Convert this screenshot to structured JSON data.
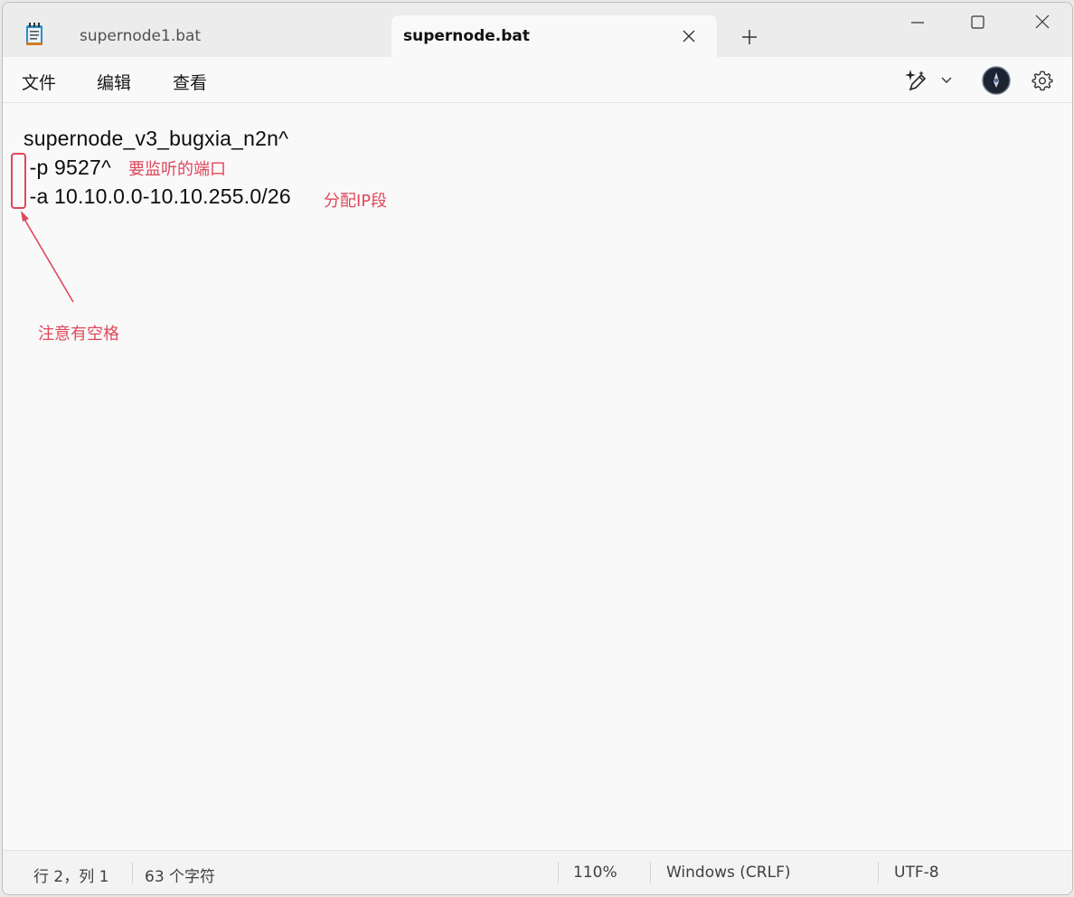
{
  "tabs": [
    {
      "label": "supernode1.bat",
      "active": false
    },
    {
      "label": "supernode.bat",
      "active": true
    }
  ],
  "menu": {
    "file": "文件",
    "edit": "编辑",
    "view": "查看"
  },
  "editor": {
    "lines": [
      "supernode_v3_bugxia_n2n^",
      " -p 9527^",
      " -a 10.10.0.0-10.10.255.0/26"
    ]
  },
  "annotations": {
    "port": "要监听的端口",
    "ip_range": "分配IP段",
    "note": "注意有空格",
    "color": "#e0475a"
  },
  "status": {
    "position": "行 2，列 1",
    "char_count": "63 个字符",
    "zoom": "110%",
    "line_ending": "Windows (CRLF)",
    "encoding": "UTF-8"
  },
  "icons": {
    "app": "notepad-icon",
    "close_tab": "close-icon",
    "new_tab": "plus-icon",
    "minimize": "minimize-icon",
    "maximize": "maximize-icon",
    "close_window": "close-icon",
    "copilot": "sparkle-pen-icon",
    "dropdown": "chevron-down-icon",
    "account": "avatar",
    "settings": "gear-icon"
  }
}
